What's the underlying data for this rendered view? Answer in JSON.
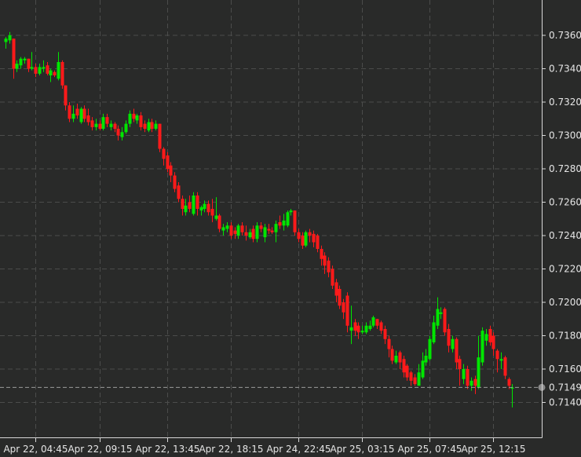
{
  "chart_data": {
    "type": "candlestick",
    "title": "",
    "xlabel": "",
    "ylabel": "",
    "ylim": [
      0.7129,
      0.738
    ],
    "grid": true,
    "interval": "15m",
    "colors": {
      "up": "#00e600",
      "down": "#ff1a1a",
      "background": "#292a29",
      "grid": "#4b4c4b",
      "axis": "#d8d8d8",
      "current": "#9a9a9a"
    },
    "y_ticks": [
      "0.7360",
      "0.7340",
      "0.7320",
      "0.7300",
      "0.7280",
      "0.7260",
      "0.7240",
      "0.7220",
      "0.7200",
      "0.7180",
      "0.7160",
      "0.7140"
    ],
    "x_ticks": [
      {
        "label": "Apr 22, 04:45",
        "index": 8
      },
      {
        "label": "Apr 22, 09:15",
        "index": 25
      },
      {
        "label": "Apr 22, 13:45",
        "index": 43
      },
      {
        "label": "Apr 22, 18:15",
        "index": 60
      },
      {
        "label": "Apr 24, 22:45",
        "index": 78
      },
      {
        "label": "Apr 25, 03:15",
        "index": 95
      },
      {
        "label": "Apr 25, 07:45",
        "index": 113
      },
      {
        "label": "Apr 25, 12:15",
        "index": 130
      }
    ],
    "current_price": "0.7149",
    "ohlc": [
      [
        0.7356,
        0.7359,
        0.7352,
        0.7358
      ],
      [
        0.7357,
        0.7362,
        0.7355,
        0.736
      ],
      [
        0.7358,
        0.7358,
        0.7334,
        0.734
      ],
      [
        0.734,
        0.7345,
        0.7338,
        0.7343
      ],
      [
        0.7342,
        0.7347,
        0.734,
        0.7346
      ],
      [
        0.7345,
        0.7347,
        0.7343,
        0.7346
      ],
      [
        0.7346,
        0.7346,
        0.7338,
        0.734
      ],
      [
        0.734,
        0.735,
        0.7339,
        0.7341
      ],
      [
        0.7341,
        0.7343,
        0.7335,
        0.7337
      ],
      [
        0.7337,
        0.7343,
        0.7336,
        0.7341
      ],
      [
        0.734,
        0.7345,
        0.7338,
        0.7341
      ],
      [
        0.7342,
        0.7344,
        0.7336,
        0.7337
      ],
      [
        0.7336,
        0.734,
        0.7332,
        0.7339
      ],
      [
        0.7338,
        0.7339,
        0.7335,
        0.7336
      ],
      [
        0.7334,
        0.735,
        0.7333,
        0.7344
      ],
      [
        0.7344,
        0.7345,
        0.7328,
        0.733
      ],
      [
        0.733,
        0.733,
        0.7315,
        0.7318
      ],
      [
        0.7318,
        0.732,
        0.7308,
        0.731
      ],
      [
        0.731,
        0.7318,
        0.7308,
        0.7313
      ],
      [
        0.7316,
        0.7319,
        0.731,
        0.7312
      ],
      [
        0.7308,
        0.7317,
        0.7307,
        0.7316
      ],
      [
        0.7316,
        0.7318,
        0.7308,
        0.731
      ],
      [
        0.7312,
        0.7316,
        0.7306,
        0.7308
      ],
      [
        0.7309,
        0.7311,
        0.7303,
        0.7305
      ],
      [
        0.7305,
        0.731,
        0.7303,
        0.7307
      ],
      [
        0.7307,
        0.7309,
        0.7303,
        0.7304
      ],
      [
        0.7304,
        0.7313,
        0.7303,
        0.7311
      ],
      [
        0.7311,
        0.7313,
        0.7305,
        0.7307
      ],
      [
        0.7305,
        0.7309,
        0.7303,
        0.7307
      ],
      [
        0.7307,
        0.7308,
        0.7302,
        0.7304
      ],
      [
        0.7304,
        0.7306,
        0.7297,
        0.73
      ],
      [
        0.7299,
        0.7305,
        0.7297,
        0.7302
      ],
      [
        0.7302,
        0.7309,
        0.7301,
        0.7307
      ],
      [
        0.7307,
        0.7315,
        0.7305,
        0.7313
      ],
      [
        0.7313,
        0.7316,
        0.7308,
        0.731
      ],
      [
        0.7309,
        0.7313,
        0.7307,
        0.7312
      ],
      [
        0.7312,
        0.7314,
        0.7303,
        0.7305
      ],
      [
        0.7307,
        0.7309,
        0.7302,
        0.7304
      ],
      [
        0.7303,
        0.731,
        0.7302,
        0.7308
      ],
      [
        0.7308,
        0.731,
        0.7302,
        0.7304
      ],
      [
        0.7304,
        0.7309,
        0.7303,
        0.7307
      ],
      [
        0.7307,
        0.7307,
        0.729,
        0.7292
      ],
      [
        0.7292,
        0.7293,
        0.7282,
        0.7286
      ],
      [
        0.7288,
        0.729,
        0.7278,
        0.728
      ],
      [
        0.7282,
        0.7284,
        0.7272,
        0.7276
      ],
      [
        0.7276,
        0.7278,
        0.7266,
        0.7268
      ],
      [
        0.727,
        0.7272,
        0.726,
        0.7262
      ],
      [
        0.7262,
        0.7264,
        0.7252,
        0.7256
      ],
      [
        0.7254,
        0.7262,
        0.7252,
        0.7258
      ],
      [
        0.726,
        0.7264,
        0.7254,
        0.7256
      ],
      [
        0.7253,
        0.7266,
        0.7252,
        0.7264
      ],
      [
        0.7264,
        0.7266,
        0.7252,
        0.7256
      ],
      [
        0.7255,
        0.7258,
        0.7252,
        0.7257
      ],
      [
        0.7256,
        0.7261,
        0.7254,
        0.7259
      ],
      [
        0.7259,
        0.7261,
        0.7252,
        0.7254
      ],
      [
        0.7256,
        0.7262,
        0.7248,
        0.7252
      ],
      [
        0.725,
        0.7263,
        0.7249,
        0.7252
      ],
      [
        0.7252,
        0.7253,
        0.7242,
        0.7244
      ],
      [
        0.7243,
        0.7247,
        0.724,
        0.7245
      ],
      [
        0.7244,
        0.7248,
        0.7242,
        0.7246
      ],
      [
        0.7246,
        0.7248,
        0.7238,
        0.724
      ],
      [
        0.7243,
        0.7245,
        0.7238,
        0.7241
      ],
      [
        0.724,
        0.7247,
        0.7238,
        0.7246
      ],
      [
        0.7246,
        0.7248,
        0.724,
        0.7242
      ],
      [
        0.7242,
        0.7246,
        0.7237,
        0.724
      ],
      [
        0.7239,
        0.7244,
        0.7238,
        0.7242
      ],
      [
        0.7244,
        0.7246,
        0.7236,
        0.7238
      ],
      [
        0.7238,
        0.7248,
        0.7236,
        0.7246
      ],
      [
        0.7246,
        0.7248,
        0.7242,
        0.7244
      ],
      [
        0.7239,
        0.7247,
        0.7236,
        0.7245
      ],
      [
        0.7244,
        0.7247,
        0.7241,
        0.7243
      ],
      [
        0.7243,
        0.7245,
        0.7241,
        0.7242
      ],
      [
        0.7242,
        0.7249,
        0.7236,
        0.7247
      ],
      [
        0.7248,
        0.7252,
        0.7244,
        0.7246
      ],
      [
        0.7246,
        0.7253,
        0.7243,
        0.7249
      ],
      [
        0.7246,
        0.7255,
        0.7245,
        0.7254
      ],
      [
        0.7254,
        0.7256,
        0.7252,
        0.7255
      ],
      [
        0.7255,
        0.7255,
        0.724,
        0.7242
      ],
      [
        0.7242,
        0.7244,
        0.7236,
        0.7238
      ],
      [
        0.724,
        0.7242,
        0.7232,
        0.7234
      ],
      [
        0.7234,
        0.7243,
        0.7233,
        0.7242
      ],
      [
        0.7242,
        0.7244,
        0.7236,
        0.724
      ],
      [
        0.7241,
        0.7243,
        0.7233,
        0.7236
      ],
      [
        0.724,
        0.7241,
        0.723,
        0.7232
      ],
      [
        0.7232,
        0.7234,
        0.7222,
        0.7226
      ],
      [
        0.7228,
        0.723,
        0.7217,
        0.7222
      ],
      [
        0.7225,
        0.7227,
        0.7215,
        0.7218
      ],
      [
        0.722,
        0.7222,
        0.7208,
        0.721
      ],
      [
        0.7212,
        0.7214,
        0.72,
        0.7204
      ],
      [
        0.7208,
        0.721,
        0.7196,
        0.7198
      ],
      [
        0.72,
        0.7202,
        0.719,
        0.7194
      ],
      [
        0.7204,
        0.7206,
        0.7182,
        0.7186
      ],
      [
        0.7183,
        0.7198,
        0.7175,
        0.7185
      ],
      [
        0.7188,
        0.719,
        0.718,
        0.7183
      ],
      [
        0.7186,
        0.7188,
        0.7178,
        0.7182
      ],
      [
        0.7182,
        0.7186,
        0.7181,
        0.7183
      ],
      [
        0.7182,
        0.7188,
        0.7181,
        0.7186
      ],
      [
        0.7184,
        0.7189,
        0.7183,
        0.7186
      ],
      [
        0.7186,
        0.7192,
        0.7185,
        0.7191
      ],
      [
        0.719,
        0.719,
        0.7184,
        0.7186
      ],
      [
        0.7188,
        0.7189,
        0.7181,
        0.7183
      ],
      [
        0.7184,
        0.7186,
        0.7175,
        0.7178
      ],
      [
        0.7178,
        0.718,
        0.7167,
        0.7172
      ],
      [
        0.7172,
        0.7174,
        0.7163,
        0.7165
      ],
      [
        0.7164,
        0.7171,
        0.7163,
        0.7168
      ],
      [
        0.717,
        0.7171,
        0.716,
        0.7164
      ],
      [
        0.7166,
        0.7168,
        0.7155,
        0.7158
      ],
      [
        0.7162,
        0.7163,
        0.7153,
        0.7155
      ],
      [
        0.7158,
        0.7159,
        0.715,
        0.7153
      ],
      [
        0.7155,
        0.7157,
        0.715,
        0.7151
      ],
      [
        0.715,
        0.7163,
        0.715,
        0.7158
      ],
      [
        0.7155,
        0.717,
        0.7154,
        0.7165
      ],
      [
        0.7164,
        0.7172,
        0.7162,
        0.7168
      ],
      [
        0.7166,
        0.718,
        0.7165,
        0.7178
      ],
      [
        0.7176,
        0.7192,
        0.7175,
        0.7188
      ],
      [
        0.7186,
        0.7203,
        0.7184,
        0.7196
      ],
      [
        0.7193,
        0.7197,
        0.719,
        0.7194
      ],
      [
        0.7196,
        0.7197,
        0.718,
        0.7182
      ],
      [
        0.7184,
        0.7187,
        0.717,
        0.7174
      ],
      [
        0.7172,
        0.718,
        0.717,
        0.7178
      ],
      [
        0.7178,
        0.7179,
        0.716,
        0.7164
      ],
      [
        0.7166,
        0.7168,
        0.715,
        0.716
      ],
      [
        0.7154,
        0.7163,
        0.7151,
        0.716
      ],
      [
        0.716,
        0.7162,
        0.7148,
        0.715
      ],
      [
        0.715,
        0.7155,
        0.7147,
        0.7153
      ],
      [
        0.7154,
        0.7156,
        0.7145,
        0.715
      ],
      [
        0.7149,
        0.718,
        0.7148,
        0.7167
      ],
      [
        0.7164,
        0.7185,
        0.7162,
        0.7183
      ],
      [
        0.7177,
        0.7184,
        0.7174,
        0.7181
      ],
      [
        0.7184,
        0.7186,
        0.7174,
        0.7176
      ],
      [
        0.718,
        0.7182,
        0.7168,
        0.7172
      ],
      [
        0.7171,
        0.7172,
        0.7158,
        0.7166
      ],
      [
        0.7165,
        0.717,
        0.716,
        0.7166
      ],
      [
        0.7167,
        0.7168,
        0.7154,
        0.7156
      ],
      [
        0.7154,
        0.7155,
        0.7148,
        0.715
      ],
      [
        0.7149,
        0.7151,
        0.7137,
        0.7149
      ]
    ]
  }
}
